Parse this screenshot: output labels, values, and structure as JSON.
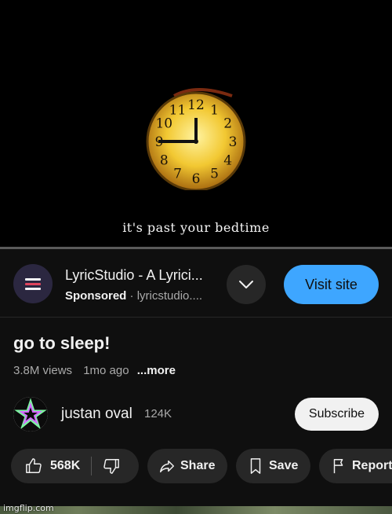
{
  "video": {
    "caption": "it's past your bedtime",
    "clock_numerals": [
      "12",
      "1",
      "2",
      "3",
      "4",
      "5",
      "6",
      "7",
      "8",
      "9",
      "10",
      "11"
    ]
  },
  "ad": {
    "title": "LyricStudio - A Lyrici...",
    "sponsored_label": "Sponsored",
    "separator": "·",
    "domain": "lyricstudio....",
    "visit_label": "Visit site",
    "logo_colors": [
      "#f4f4f8",
      "#e0455e",
      "#ffffff"
    ]
  },
  "video_info": {
    "title": "go to sleep!",
    "views": "3.8M views",
    "age": "1mo ago",
    "more_label": "...more"
  },
  "channel": {
    "name": "justan oval",
    "subscribers": "124K",
    "subscribe_label": "Subscribe"
  },
  "actions": {
    "like_count": "568K",
    "share_label": "Share",
    "save_label": "Save",
    "report_label": "Report"
  },
  "watermark": "imgflip.com",
  "colors": {
    "background": "#0f0f0f",
    "accent_blue": "#3ea6ff",
    "pill_bg": "#272727",
    "text_secondary": "#aaaaaa"
  }
}
